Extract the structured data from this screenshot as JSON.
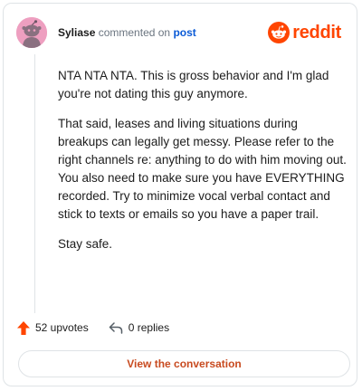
{
  "comment": {
    "username": "Syliase",
    "action_text": "commented on",
    "post_link": "post",
    "paragraphs": [
      "NTA NTA NTA. This is gross behavior and I'm glad you're not dating this guy anymore.",
      "That said, leases and living situations during breakups can legally get messy. Please refer to the right channels re: anything to do with him moving out. You also need to make sure you have EVERYTHING recorded. Try to minimize vocal verbal contact and stick to texts or emails so you have a paper trail.",
      "Stay safe."
    ]
  },
  "brand": {
    "name": "reddit",
    "color": "#ff4500"
  },
  "footer": {
    "upvotes": "52 upvotes",
    "replies": "0 replies",
    "upvote_icon_color": "#ff4500"
  },
  "cta": {
    "label": "View the conversation",
    "color": "#c84a1f"
  },
  "avatar": {
    "background": "#ee9fc0"
  }
}
